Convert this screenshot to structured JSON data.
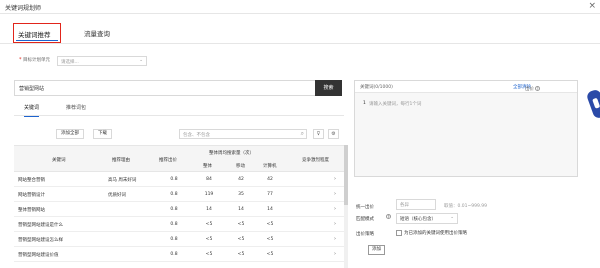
{
  "window": {
    "title": "关键词规划师",
    "close_label": "×"
  },
  "tabs": [
    {
      "label": "关键词推荐"
    },
    {
      "label": "流量查询"
    }
  ],
  "target": {
    "label": "目标计划单元",
    "placeholder": "请选择..."
  },
  "search": {
    "value": "营销型网站",
    "button_label": "搜索"
  },
  "subtabs": [
    {
      "label": "关键词"
    },
    {
      "label": "推荐词包"
    }
  ],
  "toolbar": {
    "add_all_label": "添加全部",
    "download_label": "下载",
    "filter_placeholder": "包含、不包含"
  },
  "table": {
    "headers": {
      "keyword": "关键词",
      "reason": "推荐理由",
      "bid": "推荐出价",
      "volume_group": "整体周均搜索量（次）",
      "overall": "整体",
      "mobile": "移动",
      "pc": "计算机",
      "competition": "竞争激烈程度"
    },
    "rows": [
      {
        "keyword": "网站整合营销",
        "reason": "高马 周末好词",
        "bid": "0.8",
        "overall": "84",
        "mobile": "42",
        "pc": "42"
      },
      {
        "keyword": "网站营销设计",
        "reason": "优质好词",
        "bid": "0.8",
        "overall": "119",
        "mobile": "35",
        "pc": "77"
      },
      {
        "keyword": "整体营销网站",
        "reason": "",
        "bid": "0.8",
        "overall": "14",
        "mobile": "14",
        "pc": "14"
      },
      {
        "keyword": "营销型网站建设是什么",
        "reason": "",
        "bid": "0.8",
        "overall": "<5",
        "mobile": "<5",
        "pc": "<5"
      },
      {
        "keyword": "营销型网站建设怎么样",
        "reason": "",
        "bid": "0.8",
        "overall": "<5",
        "mobile": "<5",
        "pc": "<5"
      },
      {
        "keyword": "营销型网站建设价值",
        "reason": "",
        "bid": "0.8",
        "overall": "<5",
        "mobile": "<5",
        "pc": "<5"
      }
    ]
  },
  "keyword_panel": {
    "count_label": "关键词(0/1000)",
    "clear_label": "全部清除",
    "bid_label": "出价",
    "line_number": "1",
    "placeholder": "请输入关键词，每行1个词"
  },
  "settings": {
    "unified_bid_label": "统一出价",
    "unified_bid_placeholder": "各异",
    "bid_range": "取值：0.01~999.99",
    "match_label": "匹配模式",
    "match_value": "短语（核心包含）",
    "bid_strategy_label": "出价策略",
    "bid_strategy_checkbox_label": "为已添加的关键词使用出价策略",
    "add_button_label": "添加"
  }
}
